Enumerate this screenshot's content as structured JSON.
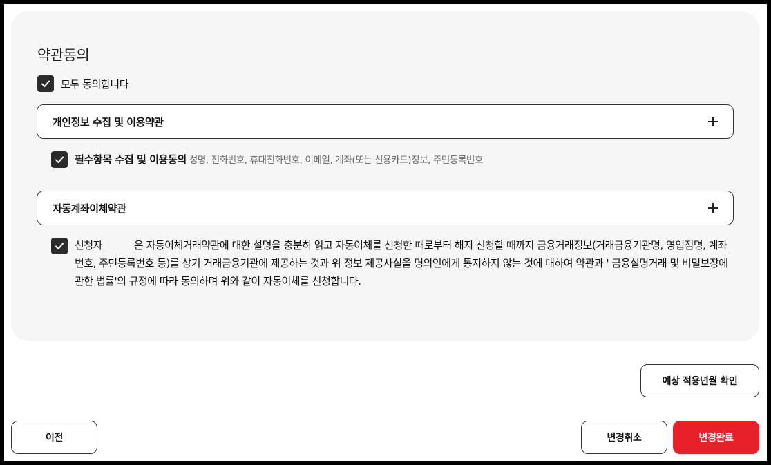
{
  "terms": {
    "title": "약관동의",
    "agree_all": "모두 동의합니다",
    "privacy": {
      "title": "개인정보 수집 및 이용약관",
      "required_label": "필수항목 수집 및 이용동의",
      "required_desc": "성명, 전화번호, 휴대전화번호, 이메일, 계좌(또는 신용카드)정보, 주민등록번호"
    },
    "autotransfer": {
      "title": "자동계좌이체약관",
      "applicant": "신청자",
      "consent_text": "은 자동이체거래약관에 대한 설명을 충분히 읽고 자동이체를 신청한 때로부터 해지 신청할 때까지 금융거래정보(거래금융기관명, 영업점명, 계좌번호, 주민등록번호 등)를 상기 거래금융기관에 제공하는 것과 위 정보 제공사실을 명의인에게 통지하지 않는 것에 대하여 약관과 ' 금융실명거래 및 비밀보장에 관한 법률'의 규정에 따라 동의하며 위와 같이 자동이체를 신청합니다."
    }
  },
  "actions": {
    "estimate": "예상 적용년월 확인",
    "prev": "이전",
    "cancel": "변경취소",
    "complete": "변경완료"
  },
  "colors": {
    "accent": "#e8202a",
    "checkbox": "#2b2b2b",
    "panel": "#f6f6f6"
  }
}
